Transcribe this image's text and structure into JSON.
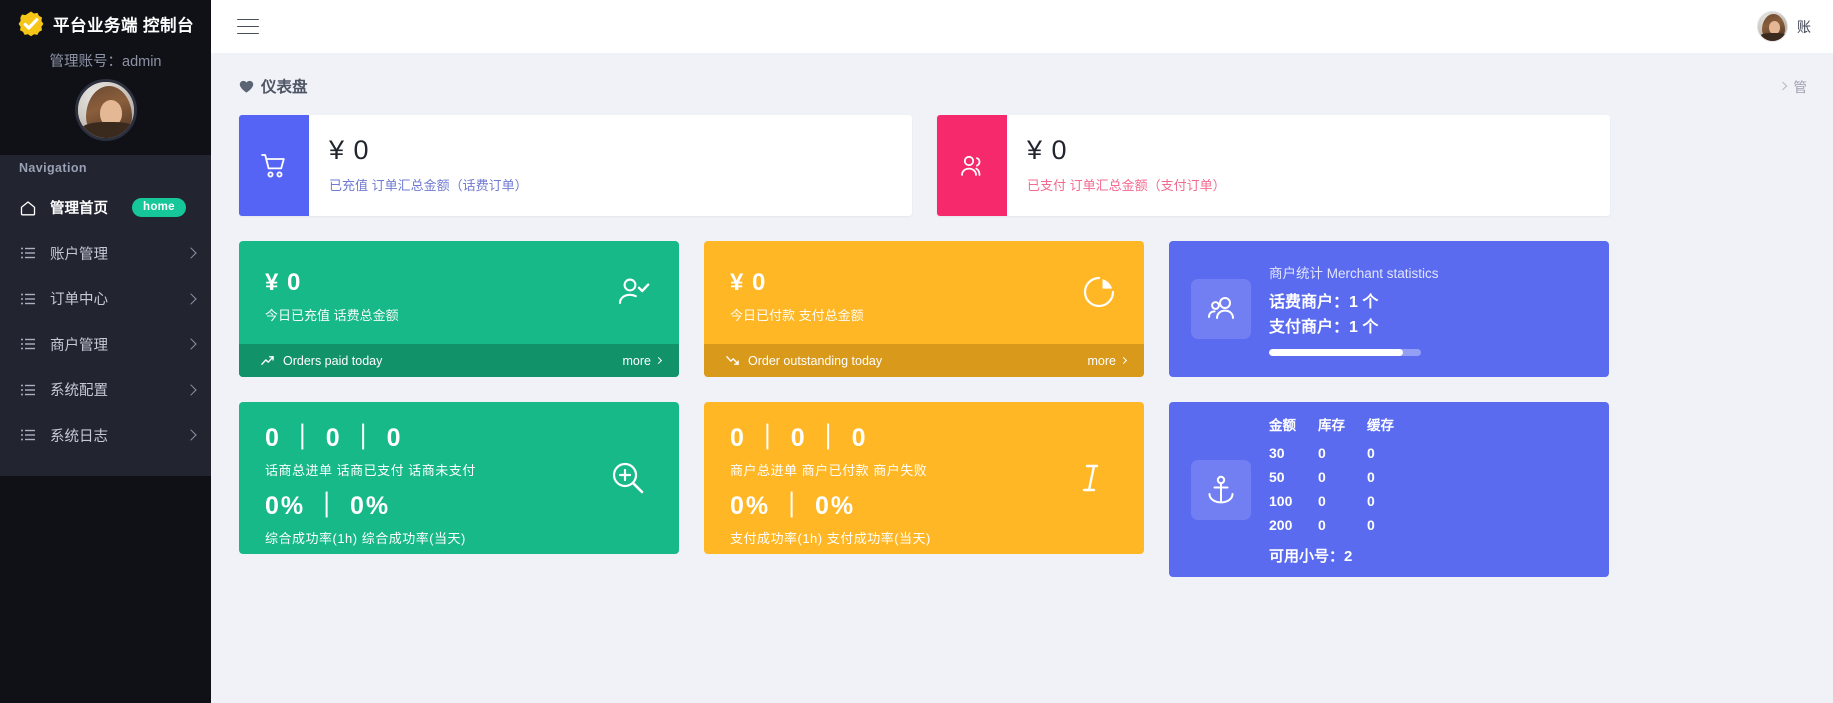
{
  "sidebar": {
    "brand_title": "平台业务端 控制台",
    "brand_logo_icon": "gear-check-icon",
    "account_label": "管理账号：admin",
    "avatar_icon": "user-avatar",
    "nav_heading": "Navigation",
    "items": [
      {
        "label": "管理首页",
        "icon": "home-icon",
        "badge": "home",
        "has_chevron": false,
        "active": true
      },
      {
        "label": "账户管理",
        "icon": "list-icon",
        "badge": "",
        "has_chevron": true,
        "active": false
      },
      {
        "label": "订单中心",
        "icon": "list-icon",
        "badge": "",
        "has_chevron": true,
        "active": false
      },
      {
        "label": "商户管理",
        "icon": "list-icon",
        "badge": "",
        "has_chevron": true,
        "active": false
      },
      {
        "label": "系统配置",
        "icon": "list-icon",
        "badge": "",
        "has_chevron": true,
        "active": false
      },
      {
        "label": "系统日志",
        "icon": "list-icon",
        "badge": "",
        "has_chevron": true,
        "active": false
      }
    ]
  },
  "topbar": {
    "menu_icon": "hamburger-icon",
    "user_avatar_icon": "user-avatar",
    "user_label": "账"
  },
  "dashboard": {
    "heart_icon": "heart-icon",
    "title": "仪表盘",
    "breadcrumb_chevron_icon": "chevron-right-icon",
    "breadcrumb_text": "管"
  },
  "summary_cards": [
    {
      "icon": "shopping-cart-icon",
      "icon_color": "#5664f5",
      "value": "¥ 0",
      "subtitle": "已充值 订单汇总金额（话费订单）"
    },
    {
      "icon": "users-icon",
      "icon_color": "#f5296b",
      "value": "¥ 0",
      "subtitle": "已支付 订单汇总金额（支付订单）"
    }
  ],
  "stat_tiles": [
    {
      "color": "#16b987",
      "value": "¥ 0",
      "subtitle": "今日已充值 话费总金额",
      "icon": "user-check-icon",
      "footer_icon": "trend-up-icon",
      "footer_label": "Orders paid today",
      "more_label": "more",
      "more_icon": "chevron-right-icon"
    },
    {
      "color": "#ffb726",
      "value": "¥ 0",
      "subtitle": "今日已付款 支付总金额",
      "icon": "pie-chart-icon",
      "footer_icon": "trend-down-icon",
      "footer_label": "Order outstanding today",
      "more_label": "more",
      "more_icon": "chevron-right-icon"
    }
  ],
  "merchant_card": {
    "icon": "users-group-icon",
    "title": "商户统计 Merchant statistics",
    "line1": "话费商户：1 个",
    "line2": "支付商户：1 个",
    "progress_percent": 88
  },
  "rate_tiles": [
    {
      "color": "#16b987",
      "counts": "0 ｜ 0 ｜ 0",
      "counts_label": "话商总进单  话商已支付  话商未支付",
      "percents": "0% ｜ 0%",
      "percents_label": "综合成功率(1h)  综合成功率(当天)",
      "icon": "zoom-in-icon"
    },
    {
      "color": "#ffb726",
      "counts": "0 ｜ 0 ｜ 0",
      "counts_label": "商户总进单  商户已付款  商户失败",
      "percents": "0% ｜ 0%",
      "percents_label": "支付成功率(1h)  支付成功率(当天)",
      "icon": "text-cursor-icon"
    }
  ],
  "stock_card": {
    "icon": "anchor-icon",
    "columns": [
      "金额",
      "库存",
      "缓存"
    ],
    "rows": [
      [
        "30",
        "0",
        "0"
      ],
      [
        "50",
        "0",
        "0"
      ],
      [
        "100",
        "0",
        "0"
      ],
      [
        "200",
        "0",
        "0"
      ]
    ],
    "footer": "可用小号：2"
  }
}
